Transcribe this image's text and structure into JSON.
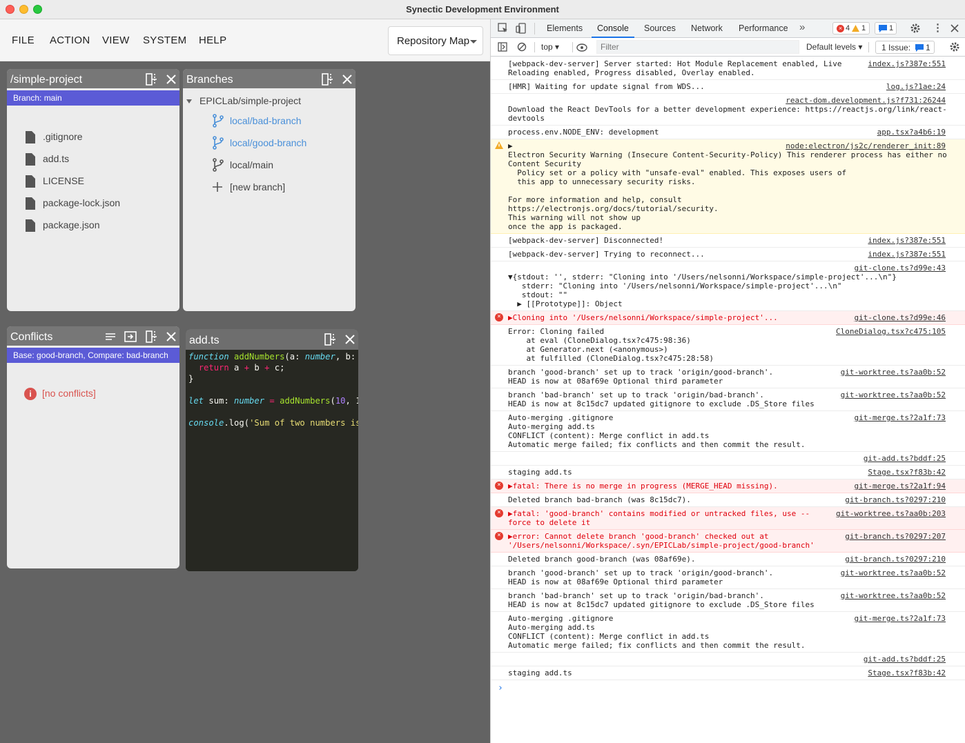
{
  "window": {
    "title": "Synectic Development Environment"
  },
  "menu": {
    "items": [
      "FILE",
      "ACTION",
      "VIEW",
      "SYSTEM",
      "HELP"
    ],
    "repo_map": "Repository Map"
  },
  "explorer": {
    "title": "/simple-project",
    "branch_label": "Branch: main",
    "files": [
      ".gitignore",
      "add.ts",
      "LICENSE",
      "package-lock.json",
      "package.json"
    ]
  },
  "branches": {
    "title": "Branches",
    "repo": "EPICLab/simple-project",
    "items": [
      "local/bad-branch",
      "local/good-branch",
      "local/main"
    ],
    "new_branch": "[new branch]"
  },
  "conflicts": {
    "title": "Conflicts",
    "compare_label": "Base: good-branch, Compare: bad-branch",
    "message": "[no conflicts]"
  },
  "editor": {
    "title": "add.ts",
    "lines": [
      "function addNumbers(a: number, b:",
      "  return a + b + c;",
      "}",
      "",
      "let sum: number = addNumbers(10, 1",
      "",
      "console.log('Sum of two numbers is"
    ]
  },
  "devtools": {
    "tabs": [
      "Elements",
      "Console",
      "Sources",
      "Network",
      "Performance"
    ],
    "active_tab": "Console",
    "errors": "4",
    "warnings": "1",
    "messages": "1",
    "context": "top",
    "filter_placeholder": "Filter",
    "levels": "Default levels",
    "issues": "1 Issue:",
    "issues_count": "1"
  },
  "console": [
    {
      "type": "log",
      "text": "[webpack-dev-server] Server started: Hot Module Replacement enabled, Live\nReloading enabled, Progress disabled, Overlay enabled.",
      "src": "index.js?387e:551"
    },
    {
      "type": "log",
      "text": "[HMR] Waiting for update signal from WDS...",
      "src": "log.js?1ae:24"
    },
    {
      "type": "log",
      "text": "\nDownload the React DevTools for a better development experience: https://reactjs.org/link/react-\ndevtools",
      "src": "react-dom.development.js?f731:26244"
    },
    {
      "type": "log",
      "text": "process.env.NODE_ENV: development",
      "src": "app.tsx?a4b6:19"
    },
    {
      "type": "warn",
      "text": "▶                                                     \nElectron Security Warning (Insecure Content-Security-Policy) This renderer process has either no\nContent Security\n  Policy set or a policy with \"unsafe-eval\" enabled. This exposes users of\n  this app to unnecessary security risks.\n\nFor more information and help, consult\nhttps://electronjs.org/docs/tutorial/security.\nThis warning will not show up\nonce the app is packaged.",
      "src": "node:electron/js2c/renderer_init:89"
    },
    {
      "type": "log",
      "text": "[webpack-dev-server] Disconnected!",
      "src": "index.js?387e:551"
    },
    {
      "type": "log",
      "text": "[webpack-dev-server] Trying to reconnect...",
      "src": "index.js?387e:551"
    },
    {
      "type": "log",
      "text": "\n▼{stdout: '', stderr: \"Cloning into '/Users/nelsonni/Workspace/simple-project'...\\n\"}\n   stderr: \"Cloning into '/Users/nelsonni/Workspace/simple-project'...\\n\"\n   stdout: \"\"\n  ▶ [[Prototype]]: Object",
      "src": "git-clone.ts?d99e:43"
    },
    {
      "type": "err",
      "text": "▶Cloning into '/Users/nelsonni/Workspace/simple-project'...",
      "src": "git-clone.ts?d99e:46"
    },
    {
      "type": "log",
      "text": "Error: Cloning failed\n    at eval (CloneDialog.tsx?c475:98:36)\n    at Generator.next (<anonymous>)\n    at fulfilled (CloneDialog.tsx?c475:28:58)",
      "src": "CloneDialog.tsx?c475:105"
    },
    {
      "type": "log",
      "text": "branch 'good-branch' set up to track 'origin/good-branch'.\nHEAD is now at 08af69e Optional third parameter",
      "src": "git-worktree.ts?aa0b:52"
    },
    {
      "type": "log",
      "text": "branch 'bad-branch' set up to track 'origin/bad-branch'.\nHEAD is now at 8c15dc7 updated gitignore to exclude .DS_Store files",
      "src": "git-worktree.ts?aa0b:52"
    },
    {
      "type": "log",
      "text": "Auto-merging .gitignore\nAuto-merging add.ts\nCONFLICT (content): Merge conflict in add.ts\nAutomatic merge failed; fix conflicts and then commit the result.",
      "src": "git-merge.ts?2a1f:73"
    },
    {
      "type": "log",
      "text": " ",
      "src": "git-add.ts?bddf:25"
    },
    {
      "type": "log",
      "text": "staging add.ts",
      "src": "Stage.tsx?f83b:42"
    },
    {
      "type": "err",
      "text": "▶fatal: There is no merge in progress (MERGE_HEAD missing).",
      "src": "git-merge.ts?2a1f:94"
    },
    {
      "type": "log",
      "text": "Deleted branch bad-branch (was 8c15dc7).",
      "src": "git-branch.ts?0297:210"
    },
    {
      "type": "err",
      "text": "▶fatal: 'good-branch' contains modified or untracked files, use --\nforce to delete it",
      "src": "git-worktree.ts?aa0b:203"
    },
    {
      "type": "err",
      "text": "▶error: Cannot delete branch 'good-branch' checked out at\n'/Users/nelsonni/Workspace/.syn/EPICLab/simple-project/good-branch'",
      "src": "git-branch.ts?0297:207"
    },
    {
      "type": "log",
      "text": "Deleted branch good-branch (was 08af69e).",
      "src": "git-branch.ts?0297:210"
    },
    {
      "type": "log",
      "text": "branch 'good-branch' set up to track 'origin/good-branch'.\nHEAD is now at 08af69e Optional third parameter",
      "src": "git-worktree.ts?aa0b:52"
    },
    {
      "type": "log",
      "text": "branch 'bad-branch' set up to track 'origin/bad-branch'.\nHEAD is now at 8c15dc7 updated gitignore to exclude .DS_Store files",
      "src": "git-worktree.ts?aa0b:52"
    },
    {
      "type": "log",
      "text": "Auto-merging .gitignore\nAuto-merging add.ts\nCONFLICT (content): Merge conflict in add.ts\nAutomatic merge failed; fix conflicts and then commit the result.",
      "src": "git-merge.ts?2a1f:73"
    },
    {
      "type": "log",
      "text": " ",
      "src": "git-add.ts?bddf:25"
    },
    {
      "type": "log",
      "text": "staging add.ts",
      "src": "Stage.tsx?f83b:42"
    }
  ],
  "colors": {
    "accent": "#5b5bd6",
    "link": "#4a90d9",
    "error": "#e0000c",
    "warning_bg": "#fffbe5"
  }
}
